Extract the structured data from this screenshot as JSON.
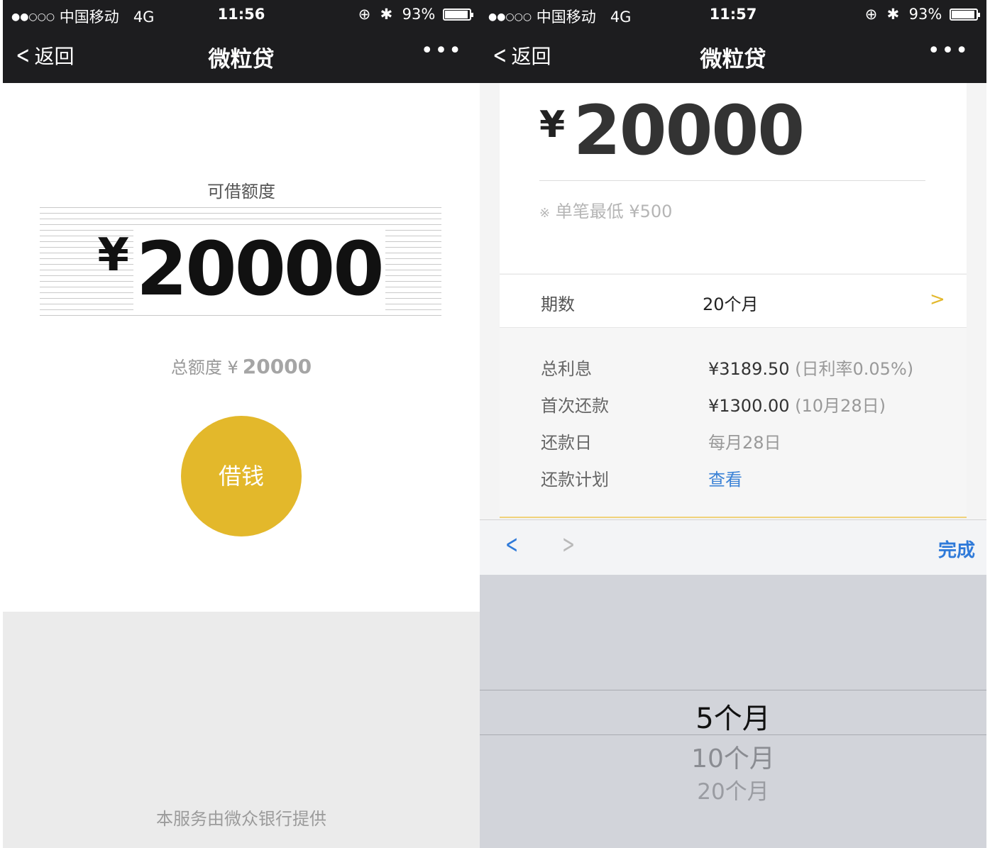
{
  "left_screen": {
    "status": {
      "carrier": "中国移动",
      "network": "4G",
      "time": "11:56",
      "battery": "93%",
      "signal_dots": "●●○○○"
    },
    "nav": {
      "back_label": "返回",
      "title": "微粒贷",
      "more_label": "•••"
    },
    "available_label": "可借额度",
    "amount_symbol": "¥",
    "amount_value": "20000",
    "total_label": "总额度 ¥",
    "total_value": "20000",
    "borrow_button": "借钱",
    "provider_text": "本服务由微众银行提供"
  },
  "right_screen": {
    "status": {
      "carrier": "中国移动",
      "network": "4G",
      "time": "11:57",
      "battery": "93%",
      "signal_dots": "●●○○○"
    },
    "nav": {
      "back_label": "返回",
      "title": "微粒贷",
      "more_label": "•••"
    },
    "amount_symbol": "¥",
    "amount_value": "20000",
    "min_note_mark": "※",
    "min_note": "单笔最低 ¥500",
    "period_label": "期数",
    "period_value": "20个月",
    "details": [
      {
        "label": "总利息",
        "value": "¥3189.50",
        "extra": "(日利率0.05%)"
      },
      {
        "label": "首次还款",
        "value": "¥1300.00",
        "extra": "(10月28日)"
      },
      {
        "label": "还款日",
        "value": "每月28日",
        "extra": ""
      },
      {
        "label": "还款计划",
        "value": "查看",
        "extra": ""
      }
    ],
    "toolbar": {
      "done_label": "完成"
    },
    "picker_options": [
      "5个月",
      "10个月",
      "20个月"
    ],
    "picker_selected": "5个月"
  },
  "colors": {
    "accent_gold": "#e3b82b",
    "link_blue": "#3b82d6",
    "nav_bg": "#1d1d1f"
  }
}
